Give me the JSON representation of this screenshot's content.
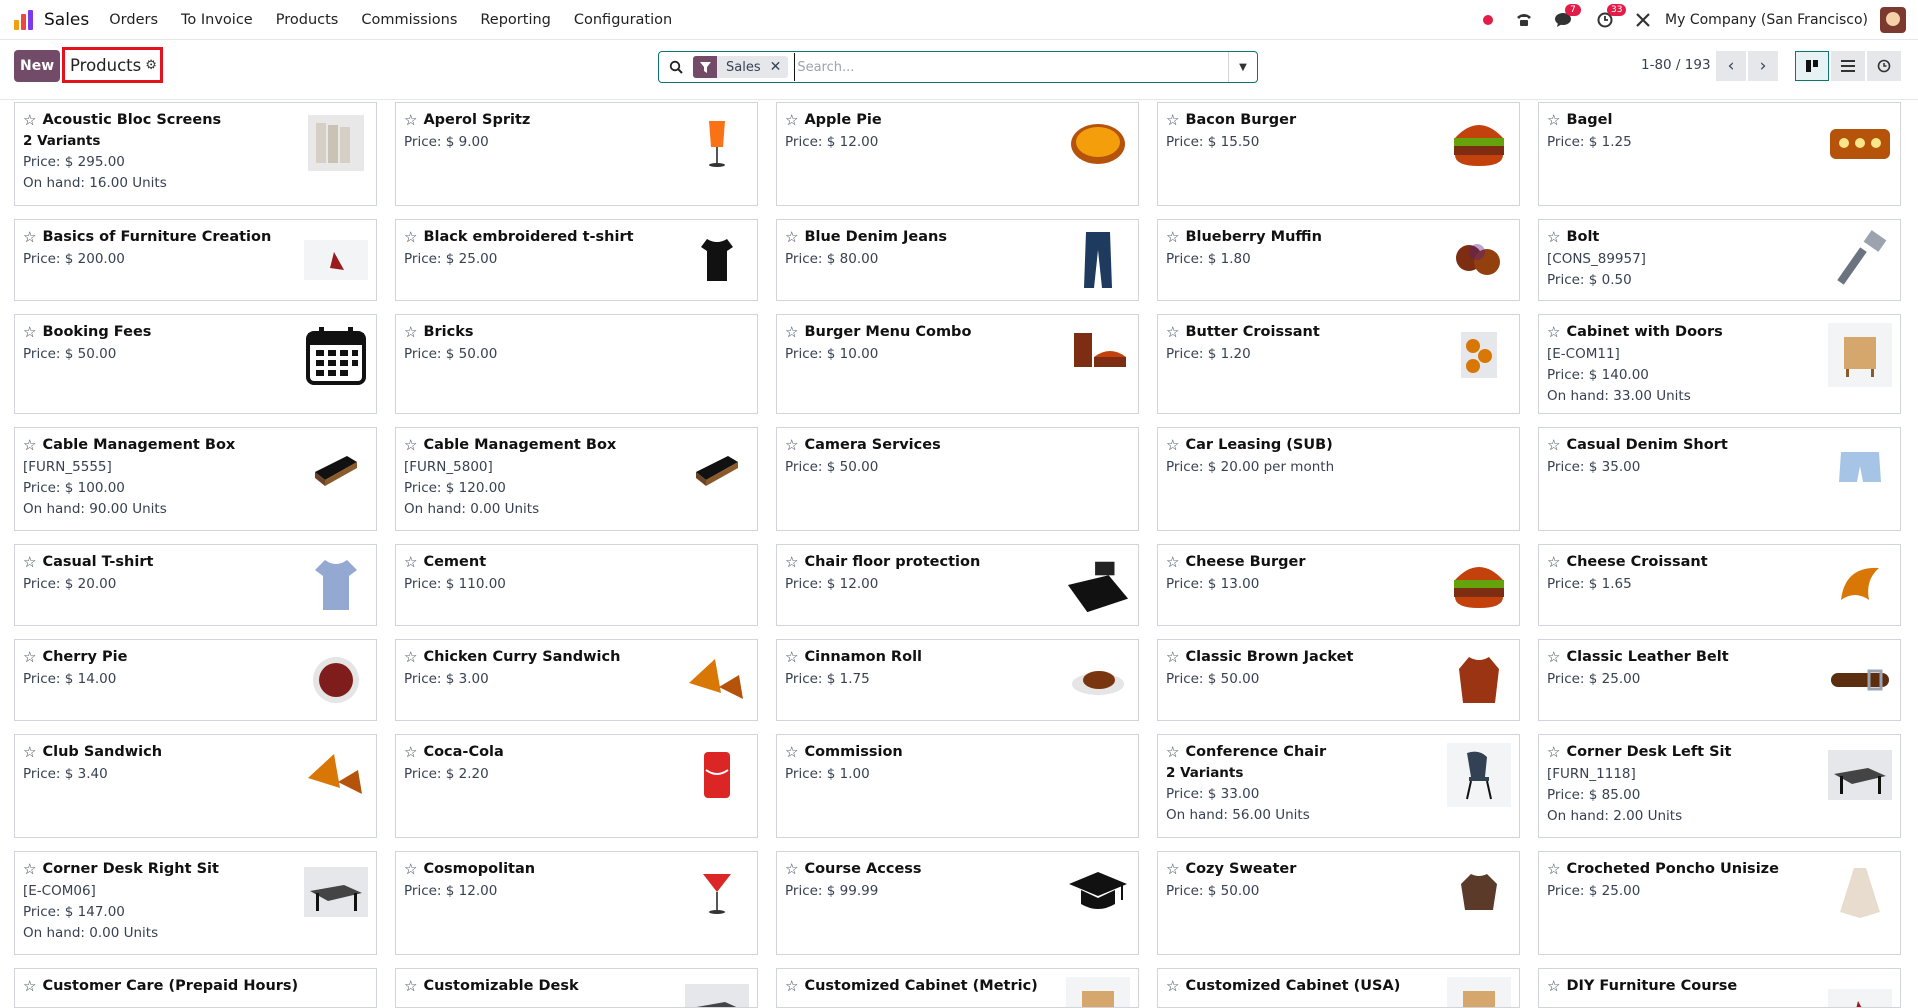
{
  "navbar": {
    "app_name": "Sales",
    "menu": [
      "Orders",
      "To Invoice",
      "Products",
      "Commissions",
      "Reporting",
      "Configuration"
    ],
    "chat_badge": "7",
    "activity_badge": "33",
    "company": "My Company (San Francisco)",
    "brand_colors": [
      "#f59e0b",
      "#ef4444",
      "#7c3aed"
    ]
  },
  "control": {
    "new_label": "New",
    "breadcrumb": "Products",
    "facet_label": "Sales",
    "search_placeholder": "Search...",
    "pager": "1-80 / 193"
  },
  "products": [
    {
      "name": "Acoustic Bloc Screens",
      "variants": "2 Variants",
      "price": "Price: $ 295.00",
      "onhand": "On hand: 16.00 Units",
      "icon": "screen"
    },
    {
      "name": "Aperol Spritz",
      "price": "Price: $ 9.00",
      "icon": "cocktail"
    },
    {
      "name": "Apple Pie",
      "price": "Price: $ 12.00",
      "icon": "pie"
    },
    {
      "name": "Bacon Burger",
      "price": "Price: $ 15.50",
      "icon": "burger"
    },
    {
      "name": "Bagel",
      "price": "Price: $ 1.25",
      "icon": "bagel"
    },
    {
      "name": "Basics of Furniture Creation",
      "price": "Price: $ 200.00",
      "icon": "furniture"
    },
    {
      "name": "Black embroidered t-shirt",
      "price": "Price: $ 25.00",
      "icon": "tshirt-black"
    },
    {
      "name": "Blue Denim Jeans",
      "price": "Price: $ 80.00",
      "icon": "jeans"
    },
    {
      "name": "Blueberry Muffin",
      "price": "Price: $ 1.80",
      "icon": "muffin"
    },
    {
      "name": "Bolt",
      "ref": "[CONS_89957]",
      "price": "Price: $ 0.50",
      "icon": "bolt"
    },
    {
      "name": "Booking Fees",
      "price": "Price: $ 50.00",
      "icon": "calendar"
    },
    {
      "name": "Bricks",
      "price": "Price: $ 50.00",
      "icon": ""
    },
    {
      "name": "Burger Menu Combo",
      "price": "Price: $ 10.00",
      "icon": "combo"
    },
    {
      "name": "Butter Croissant",
      "price": "Price: $ 1.20",
      "icon": "croissant-bag"
    },
    {
      "name": "Cabinet with Doors",
      "ref": "[E-COM11]",
      "price": "Price: $ 140.00",
      "onhand": "On hand: 33.00 Units",
      "icon": "cabinet"
    },
    {
      "name": "Cable Management Box",
      "ref": "[FURN_5555]",
      "price": "Price: $ 100.00",
      "onhand": "On hand: 90.00 Units",
      "icon": "cablebox"
    },
    {
      "name": "Cable Management Box",
      "ref": "[FURN_5800]",
      "price": "Price: $ 120.00",
      "onhand": "On hand: 0.00 Units",
      "icon": "cablebox"
    },
    {
      "name": "Camera Services",
      "price": "Price: $ 50.00",
      "icon": ""
    },
    {
      "name": "Car Leasing (SUB)",
      "price": "Price: $ 20.00 per month",
      "icon": ""
    },
    {
      "name": "Casual Denim Short",
      "price": "Price: $ 35.00",
      "icon": "shorts"
    },
    {
      "name": "Casual T-shirt",
      "price": "Price: $ 20.00",
      "icon": "tshirt-blue"
    },
    {
      "name": "Cement",
      "price": "Price: $ 110.00",
      "icon": ""
    },
    {
      "name": "Chair floor protection",
      "price": "Price: $ 12.00",
      "icon": "floormat"
    },
    {
      "name": "Cheese Burger",
      "price": "Price: $ 13.00",
      "icon": "burger"
    },
    {
      "name": "Cheese Croissant",
      "price": "Price: $ 1.65",
      "icon": "croissant"
    },
    {
      "name": "Cherry Pie",
      "price": "Price: $ 14.00",
      "icon": "cherrypie"
    },
    {
      "name": "Chicken Curry Sandwich",
      "price": "Price: $ 3.00",
      "icon": "sandwich"
    },
    {
      "name": "Cinnamon Roll",
      "price": "Price: $ 1.75",
      "icon": "roll"
    },
    {
      "name": "Classic Brown Jacket",
      "price": "Price: $ 50.00",
      "icon": "jacket"
    },
    {
      "name": "Classic Leather Belt",
      "price": "Price: $ 25.00",
      "icon": "belt"
    },
    {
      "name": "Club Sandwich",
      "price": "Price: $ 3.40",
      "icon": "sandwich"
    },
    {
      "name": "Coca-Cola",
      "price": "Price: $ 2.20",
      "icon": "can"
    },
    {
      "name": "Commission",
      "price": "Price: $ 1.00",
      "icon": ""
    },
    {
      "name": "Conference Chair",
      "variants": "2 Variants",
      "price": "Price: $ 33.00",
      "onhand": "On hand: 56.00 Units",
      "icon": "chair"
    },
    {
      "name": "Corner Desk Left Sit",
      "ref": "[FURN_1118]",
      "price": "Price: $ 85.00",
      "onhand": "On hand: 2.00 Units",
      "icon": "desk"
    },
    {
      "name": "Corner Desk Right Sit",
      "ref": "[E-COM06]",
      "price": "Price: $ 147.00",
      "onhand": "On hand: 0.00 Units",
      "icon": "desk"
    },
    {
      "name": "Cosmopolitan",
      "price": "Price: $ 12.00",
      "icon": "cocktail-red"
    },
    {
      "name": "Course Access",
      "price": "Price: $ 99.99",
      "icon": "gradcap"
    },
    {
      "name": "Cozy Sweater",
      "price": "Price: $ 50.00",
      "icon": "sweater"
    },
    {
      "name": "Crocheted Poncho Unisize",
      "price": "Price: $ 25.00",
      "icon": "poncho"
    },
    {
      "name": "Customer Care (Prepaid Hours)",
      "price": "",
      "icon": ""
    },
    {
      "name": "Customizable Desk",
      "price": "",
      "icon": "desk"
    },
    {
      "name": "Customized Cabinet (Metric)",
      "price": "",
      "icon": "cabinet"
    },
    {
      "name": "Customized Cabinet (USA)",
      "price": "",
      "icon": "cabinet"
    },
    {
      "name": "DIY Furniture Course",
      "price": "",
      "icon": "furniture"
    }
  ]
}
